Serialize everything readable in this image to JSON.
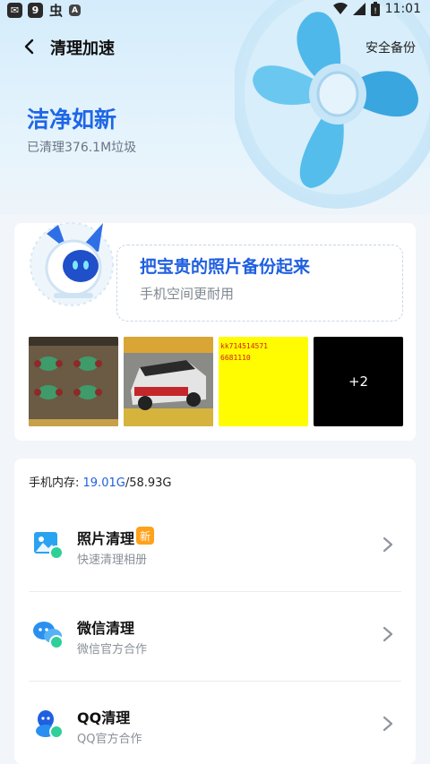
{
  "status_bar": {
    "time": "11:01",
    "left_icons": [
      "chat-notify-icon",
      "nine-icon",
      "bug-icon",
      "font-icon"
    ],
    "right_icons": [
      "wifi-icon",
      "signal-icon",
      "battery-icon"
    ]
  },
  "header": {
    "title": "清理加速",
    "action_label": "安全备份"
  },
  "hero": {
    "title": "洁净如新",
    "subtitle": "已清理376.1M垃圾"
  },
  "backup_card": {
    "title": "把宝贵的照片备份起来",
    "subtitle": "手机空间更耐用",
    "thumbnails": [
      {
        "kind": "photo",
        "icon": "poker-tables-image"
      },
      {
        "kind": "photo",
        "icon": "race-car-image"
      },
      {
        "kind": "text",
        "lines": [
          "kk714514571",
          "6681110"
        ]
      },
      {
        "kind": "more",
        "label": "+2"
      }
    ]
  },
  "storage": {
    "label": "手机内存: ",
    "used": "19.01G",
    "total": "/58.93G"
  },
  "clean_items": [
    {
      "title": "照片清理",
      "subtitle": "快速清理相册",
      "badge": "新",
      "icon": "photo-clean-icon"
    },
    {
      "title": "微信清理",
      "subtitle": "微信官方合作",
      "icon": "wechat-clean-icon"
    },
    {
      "title": "QQ清理",
      "subtitle": "QQ官方合作",
      "icon": "qq-clean-icon"
    }
  ]
}
